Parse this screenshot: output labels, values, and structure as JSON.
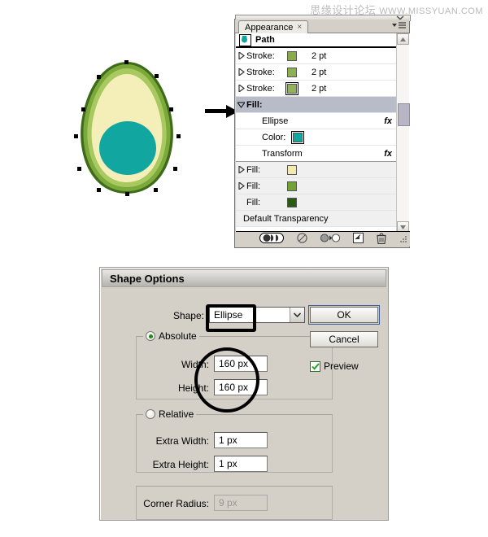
{
  "watermark": {
    "cn": "思缘设计论坛",
    "url": "WWW.MISSYUAN.COM"
  },
  "appearance_panel": {
    "tab_label": "Appearance",
    "tab_close": "×",
    "target_label": "Path",
    "rows": [
      {
        "label": "Stroke:",
        "value": "2 pt",
        "swatch": "#8aab4a",
        "disclosure": "collapsed",
        "selected": false
      },
      {
        "label": "Stroke:",
        "value": "2 pt",
        "swatch": "#8fb052",
        "disclosure": "collapsed",
        "selected": false
      },
      {
        "label": "Stroke:",
        "value": "2 pt",
        "swatch": "#93b259",
        "disclosure": "collapsed",
        "selected": true
      },
      {
        "label": "Fill:",
        "value": "",
        "swatch": "",
        "disclosure": "expanded",
        "selected": true
      }
    ],
    "fill_children": [
      {
        "label": "Ellipse",
        "fx": "fx",
        "swatch": ""
      },
      {
        "label": "Color:",
        "fx": "",
        "swatch": "#12a6a0"
      },
      {
        "label": "Transform",
        "fx": "fx",
        "swatch": ""
      }
    ],
    "lower_rows": [
      {
        "label": "Fill:",
        "swatch": "#f2eab0",
        "disclosure": "collapsed"
      },
      {
        "label": "Fill:",
        "swatch": "#74a335",
        "disclosure": "collapsed"
      },
      {
        "label": "Fill:",
        "swatch": "#2c5a12",
        "disclosure": "none"
      }
    ],
    "transparency_row": "Default Transparency",
    "footer_buttons": [
      "new-art-maintains-appearance-toggle",
      "clear-appearance-icon",
      "reduce-to-basic-appearance-icon",
      "duplicate-selected-item-icon",
      "delete-selected-item-icon"
    ],
    "window_controls": [
      "minimize",
      "close"
    ],
    "menu_icon": "panel-menu-icon"
  },
  "shape_options_dialog": {
    "title": "Shape Options",
    "shape_label": "Shape:",
    "shape_value": "Ellipse",
    "absolute_label": "Absolute",
    "absolute_selected": true,
    "width_label": "Width:",
    "width_value": "160 px",
    "height_label": "Height:",
    "height_value": "160 px",
    "relative_label": "Relative",
    "relative_selected": false,
    "extra_width_label": "Extra Width:",
    "extra_width_value": "1 px",
    "extra_height_label": "Extra Height:",
    "extra_height_value": "1 px",
    "corner_radius_label": "Corner Radius:",
    "corner_radius_value": "9 px",
    "corner_radius_disabled": true,
    "ok_label": "OK",
    "cancel_label": "Cancel",
    "preview_label": "Preview",
    "preview_checked": true
  },
  "illustration": {
    "name": "avocado-half-illustration",
    "colors": {
      "outer_edge": "#3e6b18",
      "rind": "#7ca93c",
      "inner_rind": "#a8c95f",
      "flesh": "#f4efb8",
      "pit": "#12a6a0",
      "anchor_point": "#000000"
    }
  }
}
